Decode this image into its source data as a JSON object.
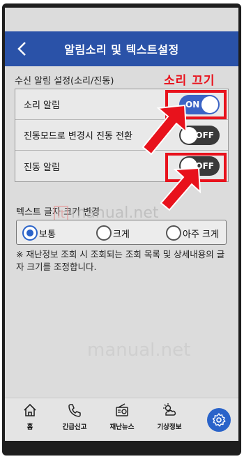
{
  "header": {
    "title": "알림소리 및 텍스트설정",
    "back_icon": "chevron-left-icon"
  },
  "notification_section": {
    "label": "수신 알림 설정(소리/진동)",
    "rows": [
      {
        "label": "소리 알림",
        "toggle": "ON",
        "state": "on"
      },
      {
        "label": "진동모드로 변경시 진동 전환",
        "toggle": "OFF",
        "state": "off"
      },
      {
        "label": "진동 알림",
        "toggle": "OFF",
        "state": "off"
      }
    ]
  },
  "annotation": {
    "text": "소리 끄기",
    "color": "#e8121c"
  },
  "text_size_section": {
    "label": "텍스트 글자 크기 변경",
    "options": [
      {
        "label": "보통",
        "selected": true
      },
      {
        "label": "크게",
        "selected": false
      },
      {
        "label": "아주 크게",
        "selected": false
      }
    ],
    "note": "※ 재난정보 조회 시 조회되는 조회 목록 및 상세내용의 글자 크기를 조정합니다."
  },
  "watermark": {
    "prefix": "It",
    "text": "manual.net"
  },
  "bottom_nav": [
    {
      "label": "홈",
      "icon": "home-icon"
    },
    {
      "label": "긴급신고",
      "icon": "phone-icon"
    },
    {
      "label": "재난뉴스",
      "icon": "radio-icon"
    },
    {
      "label": "기상정보",
      "icon": "weather-icon"
    },
    {
      "label": "",
      "icon": "gear-icon"
    }
  ],
  "colors": {
    "header": "#2a52a8",
    "accent": "#2a63c9",
    "annotation": "#e8121c"
  }
}
